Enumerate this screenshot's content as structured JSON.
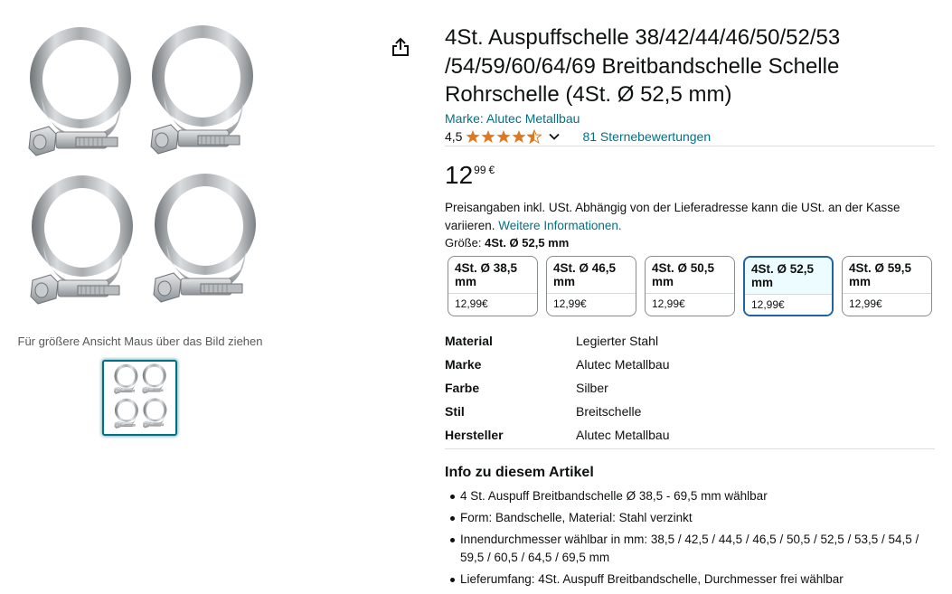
{
  "gallery": {
    "hover_hint": "Für größere Ansicht Maus über das Bild ziehen"
  },
  "product": {
    "title": "4St. Auspuffschelle 38/42/44/46/50/52/53 /54/59/60/64/69 Breitbandschelle Schelle Rohrschelle (4St. Ø 52,5 mm)",
    "brand_link": "Marke: Alutec Metallbau",
    "rating_value": "4,5",
    "rating_stars": 4.5,
    "ratings_count_link": "81 Sternebewertungen",
    "star_color": "#de7921",
    "price": {
      "whole": "12",
      "fraction": "99",
      "symbol": "€"
    },
    "tax_note": "Preisangaben inkl. USt. Abhängig von der Lieferadresse kann die USt. an der Kasse variieren.",
    "tax_link": "Weitere Informationen.",
    "size": {
      "label": "Größe:",
      "selected": "4St. Ø 52,5 mm",
      "options": [
        {
          "name": "4St. Ø 38,5 mm",
          "price": "12,99€"
        },
        {
          "name": "4St. Ø 46,5 mm",
          "price": "12,99€"
        },
        {
          "name": "4St. Ø 50,5 mm",
          "price": "12,99€"
        },
        {
          "name": "4St. Ø 52,5 mm",
          "price": "12,99€"
        },
        {
          "name": "4St. Ø 59,5 mm",
          "price": "12,99€"
        }
      ]
    },
    "specs": [
      {
        "key": "Material",
        "value": "Legierter Stahl"
      },
      {
        "key": "Marke",
        "value": "Alutec Metallbau"
      },
      {
        "key": "Farbe",
        "value": "Silber"
      },
      {
        "key": "Stil",
        "value": "Breitschelle"
      },
      {
        "key": "Hersteller",
        "value": "Alutec Metallbau"
      }
    ],
    "info_title": "Info zu diesem Artikel",
    "bullets": [
      "4 St. Auspuff Breitbandschelle Ø 38,5 - 69,5 mm wählbar",
      "Form: Bandschelle, Material: Stahl verzinkt",
      "Innendurchmesser wählbar in mm: 38,5 / 42,5 / 44,5 / 46,5 / 50,5 / 52,5 / 53,5 / 54,5 / 59,5 / 60,5 / 64,5 / 69,5 mm",
      "Lieferumfang: 4St. Auspuff Breitbandschelle, Durchmesser frei wählbar"
    ]
  },
  "colors": {
    "link": "#007185",
    "selected_border": "#2162a1",
    "star": "#de7921"
  }
}
